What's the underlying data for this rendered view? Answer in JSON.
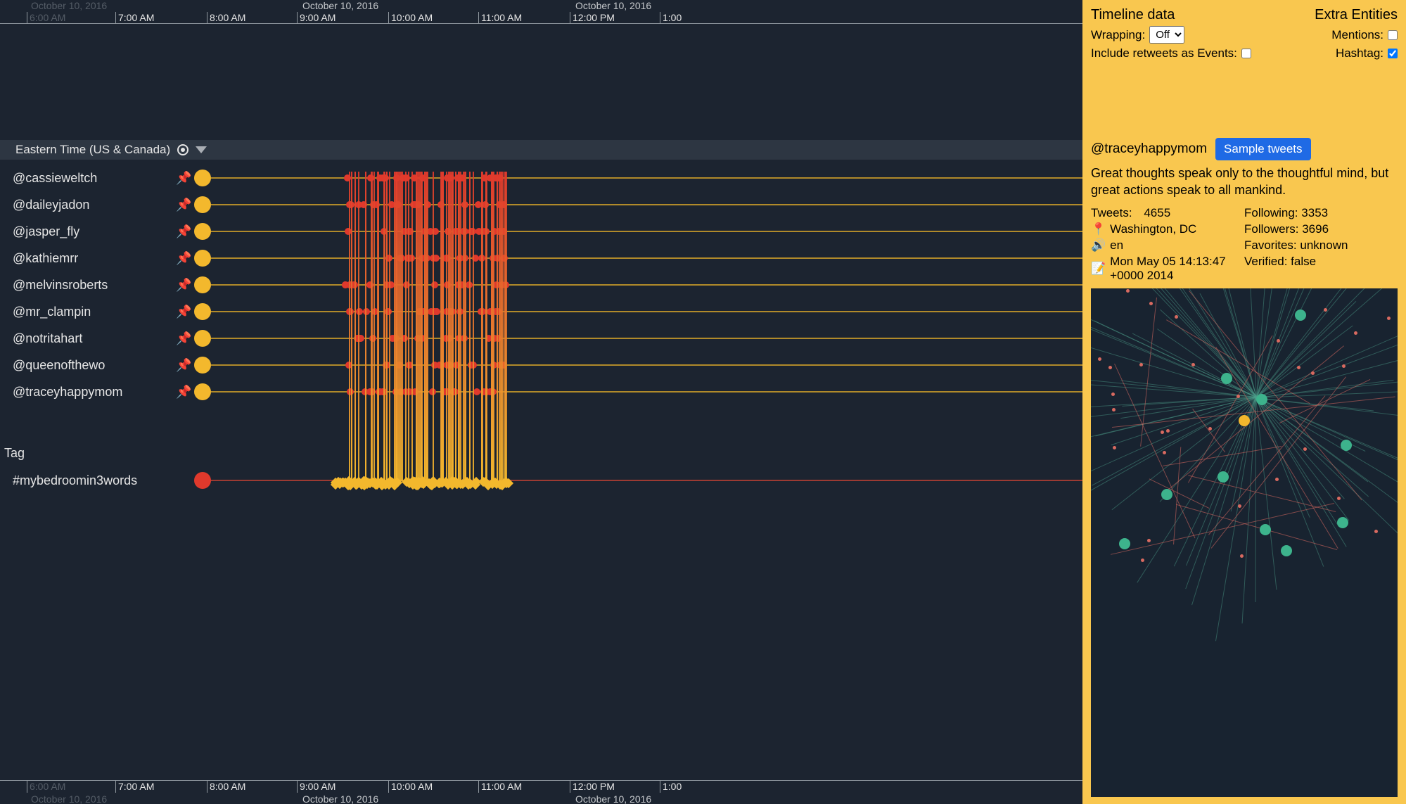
{
  "ruler": {
    "dates": [
      "October 10, 2016",
      "October 10, 2016",
      "October 10, 2016"
    ],
    "hours": [
      "6:00 AM",
      "7:00 AM",
      "8:00 AM",
      "9:00 AM",
      "10:00 AM",
      "11:00 AM",
      "12:00 PM",
      "1:00"
    ]
  },
  "timezone": "Eastern Time (US & Canada)",
  "users": [
    {
      "handle": "@cassieweltch"
    },
    {
      "handle": "@daileyjadon"
    },
    {
      "handle": "@jasper_fly"
    },
    {
      "handle": "@kathiemrr"
    },
    {
      "handle": "@melvinsroberts"
    },
    {
      "handle": "@mr_clampin"
    },
    {
      "handle": "@notritahart"
    },
    {
      "handle": "@queenofthewo"
    },
    {
      "handle": "@traceyhappymom"
    }
  ],
  "tag_section_label": "Tag",
  "tags": [
    {
      "name": "#mybedroomin3words"
    }
  ],
  "panel": {
    "title_left": "Timeline data",
    "title_right": "Extra Entities",
    "wrapping_label": "Wrapping:",
    "wrapping_value": "Off",
    "retweets_label": "Include retweets as Events:",
    "retweets_checked": false,
    "mentions_label": "Mentions:",
    "mentions_checked": false,
    "hashtag_label": "Hashtag:",
    "hashtag_checked": true,
    "handle": "@traceyhappymom",
    "sample_btn": "Sample tweets",
    "bio": "Great thoughts speak only to the thoughtful mind, but great actions speak to all mankind.",
    "stats": {
      "tweets_label": "Tweets:",
      "tweets": "4655",
      "following_label": "Following:",
      "following": "3353",
      "location_icon": "📍",
      "location": "Washington, DC",
      "followers_label": "Followers:",
      "followers": "3696",
      "lang_icon": "🔊",
      "lang": "en",
      "favorites_label": "Favorites:",
      "favorites": "unknown",
      "created_icon": "📝",
      "created": "Mon May 05 14:13:47 +0000 2014",
      "verified_label": "Verified:",
      "verified": "false"
    }
  },
  "colors": {
    "bg": "#1c2430",
    "panel_bg": "#f9c74f",
    "yellow": "#f3b82d",
    "red": "#e0392c",
    "blue": "#1f6ae5",
    "green": "#3db38c"
  }
}
